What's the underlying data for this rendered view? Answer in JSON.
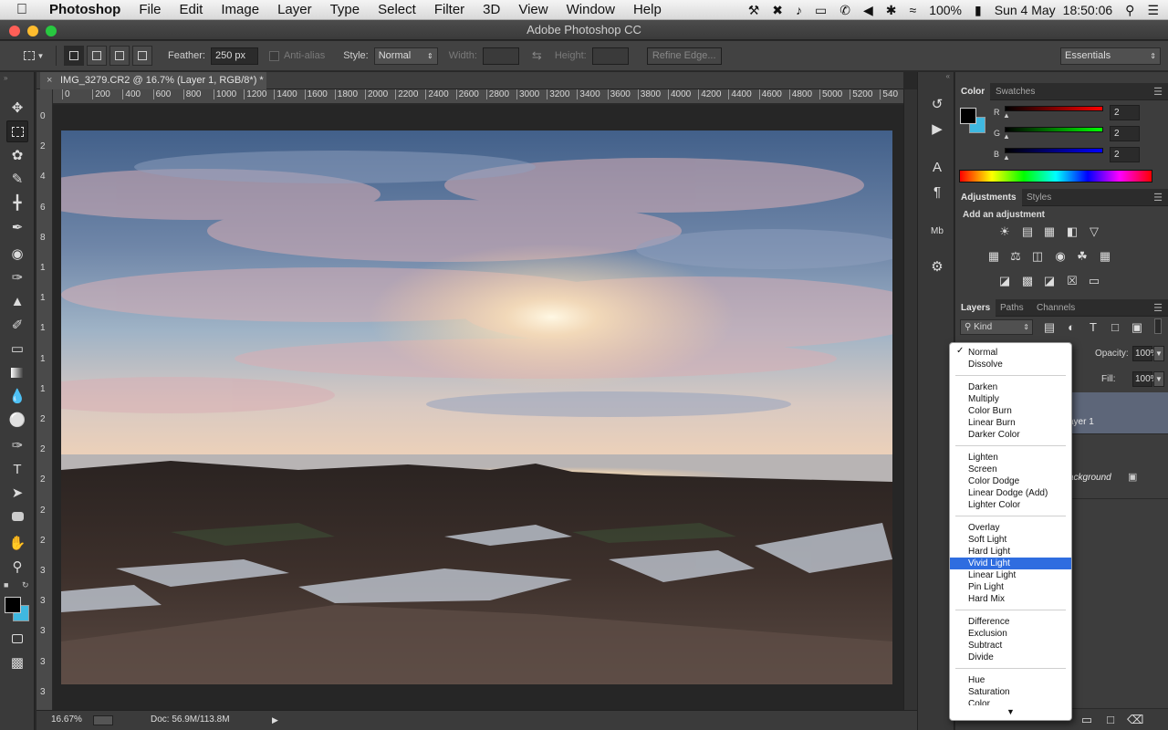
{
  "menubar": {
    "app": "Photoshop",
    "items": [
      "File",
      "Edit",
      "Image",
      "Layer",
      "Type",
      "Select",
      "Filter",
      "3D",
      "View",
      "Window",
      "Help"
    ],
    "battery": "100%",
    "date": "Sun 4 May",
    "time": "18:50:06"
  },
  "window": {
    "title": "Adobe Photoshop CC"
  },
  "options": {
    "feather_label": "Feather:",
    "feather_value": "250 px",
    "antialias_label": "Anti-alias",
    "style_label": "Style:",
    "style_value": "Normal",
    "width_label": "Width:",
    "height_label": "Height:",
    "refine_label": "Refine Edge...",
    "workspace": "Essentials"
  },
  "document": {
    "tab_title": "IMG_3279.CR2 @ 16.7% (Layer 1, RGB/8*) *",
    "ruler_h": [
      "0",
      "200",
      "400",
      "600",
      "800",
      "1000",
      "1200",
      "1400",
      "1600",
      "1800",
      "2000",
      "2200",
      "2400",
      "2600",
      "2800",
      "3000",
      "3200",
      "3400",
      "3600",
      "3800",
      "4000",
      "4200",
      "4400",
      "4600",
      "4800",
      "5000",
      "5200",
      "540"
    ],
    "ruler_v": [
      "0",
      "2",
      "4",
      "6",
      "8",
      "1",
      "1",
      "1",
      "1",
      "1",
      "2",
      "2",
      "2",
      "2",
      "2",
      "3",
      "3",
      "3",
      "3",
      "3",
      "4"
    ],
    "zoom": "16.67%",
    "doc_size": "Doc: 56.9M/113.8M"
  },
  "color_panel": {
    "tabs": [
      "Color",
      "Swatches"
    ],
    "channels": [
      {
        "label": "R",
        "value": "2"
      },
      {
        "label": "G",
        "value": "2"
      },
      {
        "label": "B",
        "value": "2"
      }
    ],
    "foreground": "#000000",
    "background": "#3fb8e0"
  },
  "adjustments_panel": {
    "tabs": [
      "Adjustments",
      "Styles"
    ],
    "heading": "Add an adjustment"
  },
  "layers_panel": {
    "tabs": [
      "Layers",
      "Paths",
      "Channels"
    ],
    "kind": "Kind",
    "opacity_label": "Opacity:",
    "opacity_value": "100%",
    "fill_label": "Fill:",
    "fill_value": "100%",
    "layers": [
      {
        "name": "ayer 1"
      },
      {
        "name": "ackground"
      }
    ]
  },
  "blend_menu": {
    "groups": [
      [
        "Normal",
        "Dissolve"
      ],
      [
        "Darken",
        "Multiply",
        "Color Burn",
        "Linear Burn",
        "Darker Color"
      ],
      [
        "Lighten",
        "Screen",
        "Color Dodge",
        "Linear Dodge (Add)",
        "Lighter Color"
      ],
      [
        "Overlay",
        "Soft Light",
        "Hard Light",
        "Vivid Light",
        "Linear Light",
        "Pin Light",
        "Hard Mix"
      ],
      [
        "Difference",
        "Exclusion",
        "Subtract",
        "Divide"
      ],
      [
        "Hue",
        "Saturation",
        "Color"
      ]
    ],
    "checked": "Normal",
    "highlighted": "Vivid Light"
  }
}
